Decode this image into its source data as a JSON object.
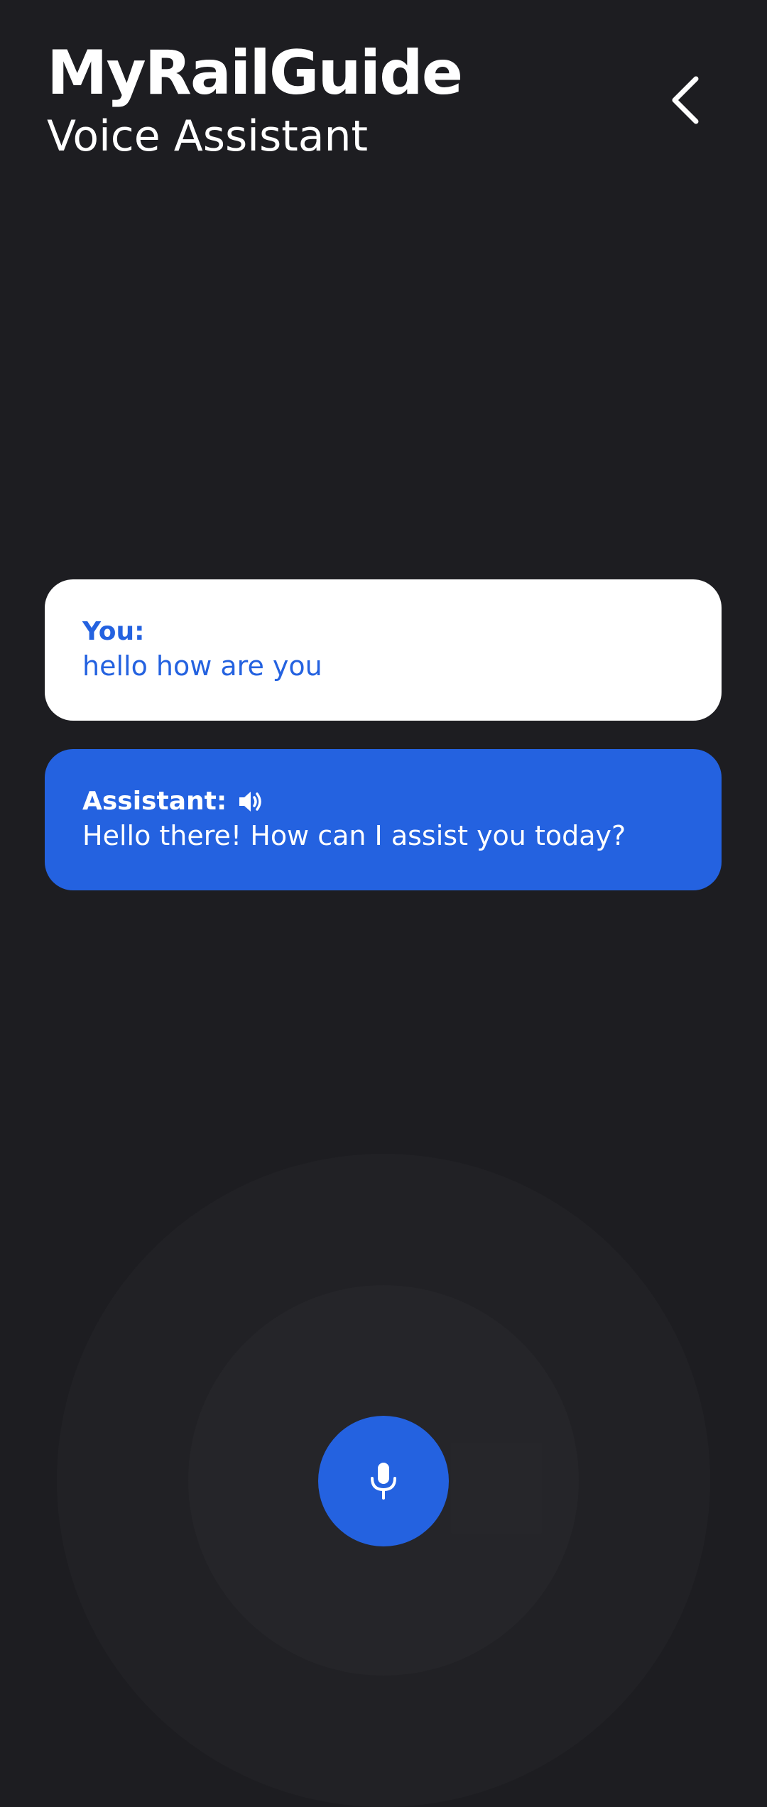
{
  "header": {
    "title": "MyRailGuide",
    "subtitle": "Voice Assistant"
  },
  "conversation": {
    "user": {
      "speaker": "You:",
      "message": "hello how are you"
    },
    "assistant": {
      "speaker": "Assistant:",
      "message": "Hello there! How can I assist you today?"
    }
  },
  "icons": {
    "back": "chevron-left-icon",
    "speaker": "speaker-icon",
    "mic": "microphone-icon"
  },
  "colors": {
    "background": "#1d1d21",
    "accent": "#2462e0",
    "user_bubble": "#ffffff"
  }
}
